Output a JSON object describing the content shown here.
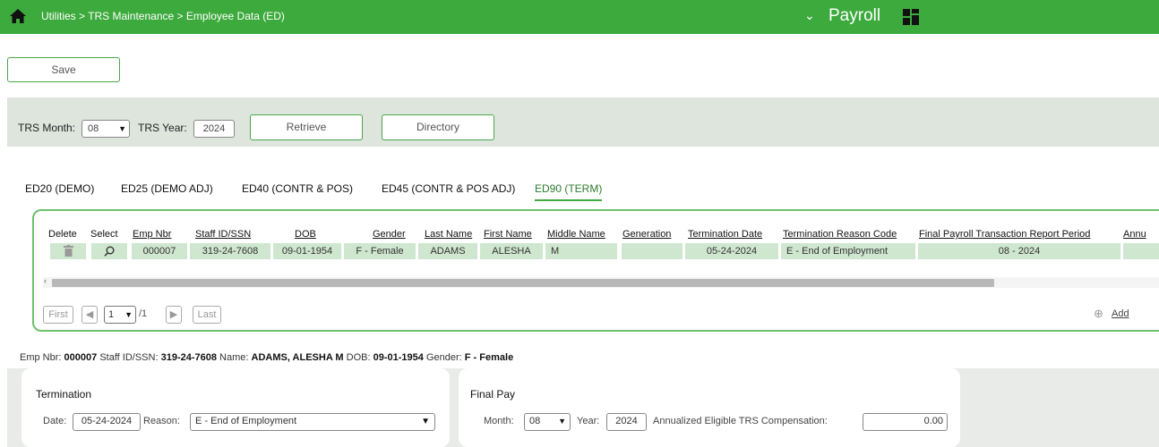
{
  "header": {
    "breadcrumb": "Utilities > TRS Maintenance > Employee Data (ED)",
    "app_name": "Payroll"
  },
  "toolbar": {
    "save_label": "Save"
  },
  "filter": {
    "trs_month_label": "TRS Month:",
    "trs_month_value": "08",
    "trs_year_label": "TRS Year:",
    "trs_year_value": "2024",
    "retrieve_label": "Retrieve",
    "directory_label": "Directory"
  },
  "tabs": [
    {
      "label": "ED20 (DEMO)"
    },
    {
      "label": "ED25 (DEMO ADJ)"
    },
    {
      "label": "ED40 (CONTR & POS)"
    },
    {
      "label": "ED45 (CONTR & POS ADJ)"
    },
    {
      "label": "ED90 (TERM)",
      "active": true
    }
  ],
  "grid": {
    "headers": [
      "Delete",
      "Select",
      "Emp Nbr",
      "Staff ID/SSN",
      "DOB",
      "Gender",
      "Last Name",
      "First Name",
      "Middle Name",
      "Generation",
      "Termination Date",
      "Termination Reason Code",
      "Final Payroll Transaction Report Period",
      "Annu"
    ],
    "row": {
      "emp_nbr": "000007",
      "staff_id": "319-24-7608",
      "dob": "09-01-1954",
      "gender": "F - Female",
      "last_name": "ADAMS",
      "first_name": "ALESHA",
      "middle_name": "M",
      "generation": "",
      "termination_date": "05-24-2024",
      "termination_reason": "E - End of Employment",
      "final_period": "08 - 2024"
    },
    "pagination": {
      "first": "First",
      "last": "Last",
      "page": "1",
      "of": "/1"
    },
    "add_label": "Add"
  },
  "summary": {
    "emp_nbr_label": "Emp Nbr:",
    "emp_nbr": "000007",
    "staff_label": "Staff ID/SSN:",
    "staff_id": "319-24-7608",
    "name_label": "Name:",
    "name": "ADAMS, ALESHA M",
    "dob_label": "DOB:",
    "dob": "09-01-1954",
    "gender_label": "Gender:",
    "gender": "F - Female"
  },
  "termination": {
    "title": "Termination",
    "date_label": "Date:",
    "date_value": "05-24-2024",
    "reason_label": "Reason:",
    "reason_value": "E - End of Employment"
  },
  "final_pay": {
    "title": "Final Pay",
    "month_label": "Month:",
    "month_value": "08",
    "year_label": "Year:",
    "year_value": "2024",
    "comp_label": "Annualized Eligible TRS Compensation:",
    "comp_value": "0.00"
  },
  "colors": {
    "header_green": "#3daa3d",
    "cell_green": "#cfe6cf",
    "filter_bg": "#dde5dc"
  }
}
